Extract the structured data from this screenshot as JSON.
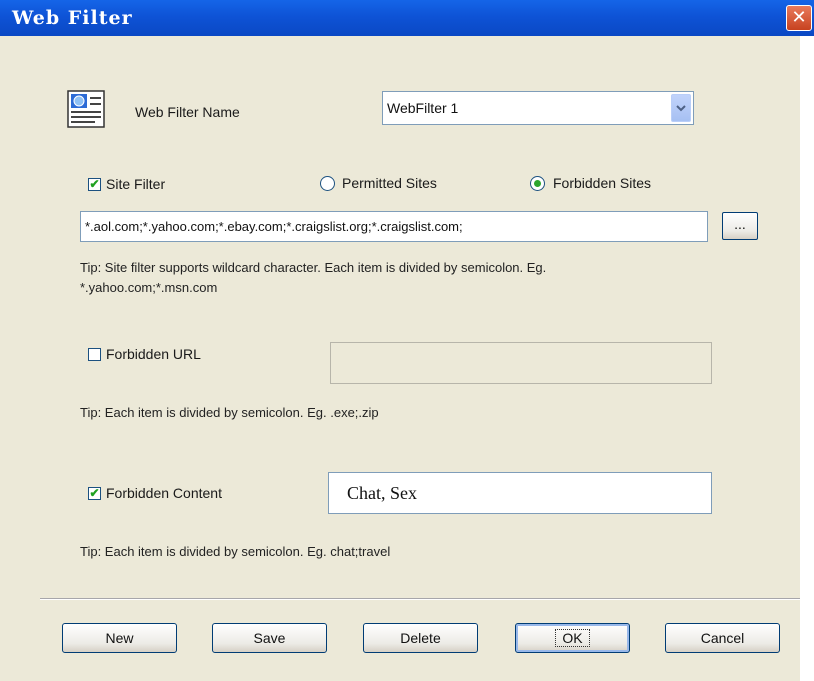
{
  "window": {
    "title": "Web Filter",
    "close_glyph": "✕"
  },
  "filter_name": {
    "label": "Web Filter Name",
    "value": "WebFilter 1",
    "icon": "filter-document-icon"
  },
  "site_filter": {
    "label": "Site Filter",
    "checked": true,
    "permitted_label": "Permitted Sites",
    "forbidden_label": "Forbidden Sites",
    "selected": "forbidden",
    "value": "*.aol.com;*.yahoo.com;*.ebay.com;*.craigslist.org;*.craigslist.com;",
    "browse_label": "...",
    "tip": "Tip: Site filter supports wildcard character. Each item is divided by semicolon. Eg. *.yahoo.com;*.msn.com"
  },
  "forbidden_url": {
    "label": "Forbidden URL",
    "checked": false,
    "value": "",
    "tip": "Tip: Each item is divided by semicolon. Eg. .exe;.zip"
  },
  "forbidden_content": {
    "label": "Forbidden Content",
    "checked": true,
    "value": "Chat, Sex",
    "tip": "Tip: Each item is divided by semicolon. Eg. chat;travel"
  },
  "buttons": {
    "new": "New",
    "save": "Save",
    "delete": "Delete",
    "ok": "OK",
    "cancel": "Cancel"
  },
  "colors": {
    "titlebar": "#0A48C4",
    "dialog_bg": "#ECE9D8",
    "check": "#21A121"
  }
}
